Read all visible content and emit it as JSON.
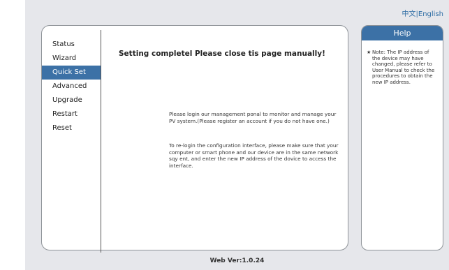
{
  "language": {
    "chinese": "中文",
    "separator": "|",
    "english": "English"
  },
  "nav": {
    "items": [
      {
        "label": "Status"
      },
      {
        "label": "Wizard"
      },
      {
        "label": "Quick Set",
        "active": true
      },
      {
        "label": "Advanced"
      },
      {
        "label": "Upgrade"
      },
      {
        "label": "Restart"
      },
      {
        "label": "Reset"
      }
    ]
  },
  "main": {
    "title": "Setting completel Please close tis page manually!",
    "message1": "Please login our management ponal to monitor and manage your PV system.(Please register an account if you do not have one.)",
    "message2": "To re-login the configuration interface, please make sure that your computer or srnart phone and our device are in the same network sqy ent, and enter the new IP address of the dovice to access the interface."
  },
  "help": {
    "title": "Help",
    "bullet": "★",
    "note": "Note: The IP address of the device may have changed, please refer to User Manual to check the procedures to obtain the new IP address."
  },
  "footer": {
    "version": "Web Ver:1.0.24"
  },
  "colors": {
    "accent": "#3c71a6",
    "background": "#e6e7eb",
    "link": "#2f6ea5"
  }
}
